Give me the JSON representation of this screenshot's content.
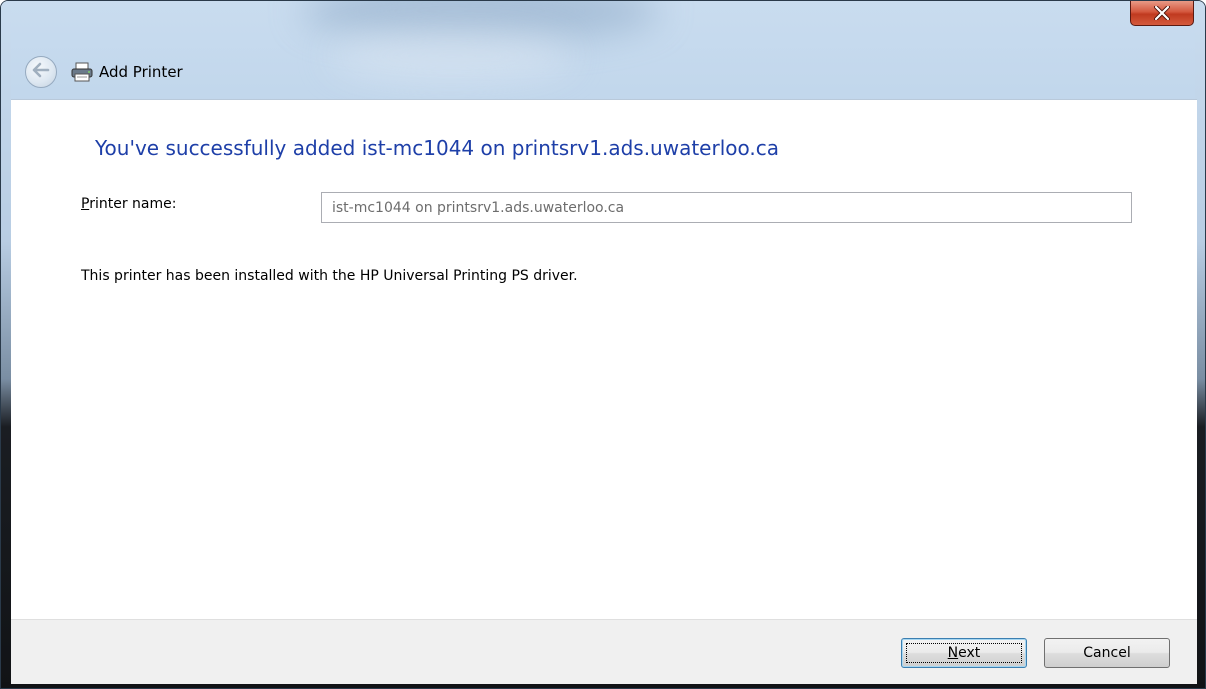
{
  "window": {
    "title": "Add Printer",
    "close_symbol": "close-icon"
  },
  "main": {
    "heading": "You've successfully added ist-mc1044 on printsrv1.ads.uwaterloo.ca",
    "printer_name_label_accel": "P",
    "printer_name_label_rest": "rinter name:",
    "printer_name_value": "ist-mc1044 on printsrv1.ads.uwaterloo.ca",
    "driver_info": "This printer has been installed with the HP Universal Printing PS driver."
  },
  "footer": {
    "next_accel": "N",
    "next_rest": "ext",
    "cancel_label": "Cancel"
  },
  "colors": {
    "heading": "#1e3fa8",
    "close_button": "#c03a20"
  },
  "icons": [
    "back-arrow-icon",
    "printer-icon",
    "close-icon"
  ]
}
